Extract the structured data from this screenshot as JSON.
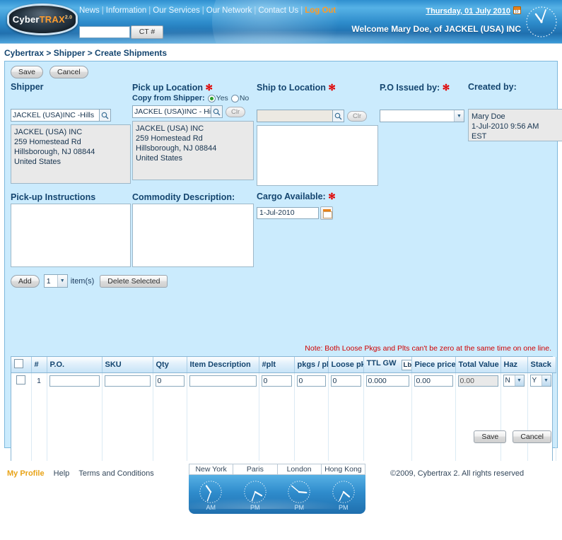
{
  "header": {
    "logo": {
      "part1": "Cyber",
      "part2": "TRAX",
      "version": "2.0"
    },
    "nav": [
      {
        "label": "News",
        "type": "link"
      },
      {
        "label": "Information",
        "type": "link"
      },
      {
        "label": "Our Services",
        "type": "link"
      },
      {
        "label": "Our Network",
        "type": "link"
      },
      {
        "label": "Contact Us",
        "type": "link"
      },
      {
        "label": "Log Out",
        "type": "logout"
      }
    ],
    "ct_search": {
      "value": "",
      "button_label": "CT #"
    },
    "date": "Thursday, 01 July 2010",
    "welcome": "Welcome Mary Doe, of JACKEL (USA) INC",
    "calendar_icon": "calendar-icon",
    "analog_clock_icon": "analog-clock-icon"
  },
  "breadcrumb": "Cybertrax > Shipper > Create Shipments",
  "toolbar": {
    "save_label": "Save",
    "cancel_label": "Cancel"
  },
  "form": {
    "shipper": {
      "title": "Shipper",
      "lookup_value": "JACKEL (USA)INC -Hills",
      "lookup_icon": "magnifier-icon",
      "address": "JACKEL (USA) INC\n259 Homestead Rd\nHillsborough, NJ  08844\nUnited States"
    },
    "pickup": {
      "title": "Pick up Location",
      "required_mark": "✻",
      "copy_label": "Copy from Shipper:",
      "yes_label": "Yes",
      "no_label": "No",
      "copy_selected": "Yes",
      "lookup_value": "JACKEL (USA)INC - Hills",
      "lookup_icon": "magnifier-icon",
      "clear_label": "Clr",
      "address": "JACKEL (USA) INC\n259 Homestead Rd\nHillsborough, NJ  08844\nUnited States"
    },
    "shipto": {
      "title": "Ship to Location",
      "required_mark": "✻",
      "lookup_value": "",
      "lookup_placeholder": "",
      "lookup_icon": "magnifier-icon",
      "clear_label": "Clr",
      "address": ""
    },
    "po_issued": {
      "title": "P.O Issued by:",
      "required_mark": "✻",
      "selected": ""
    },
    "created_by": {
      "title": "Created by:",
      "value": "Mary Doe\n1-Jul-2010  9:56 AM\nEST"
    },
    "pickup_instructions": {
      "title": "Pick-up Instructions",
      "value": ""
    },
    "commodity_description": {
      "title": "Commodity Description:",
      "value": ""
    },
    "cargo_available": {
      "title": "Cargo Available:",
      "required_mark": "✻",
      "value": "1-Jul-2010",
      "calendar_icon": "calendar-picker-icon"
    }
  },
  "items": {
    "add_label": "Add",
    "count_value": "1",
    "items_word": "item(s)",
    "delete_label": "Delete Selected",
    "note": "Note: Both Loose Pkgs and Plts can't be zero at the same time on one line.",
    "columns": [
      "",
      "#",
      "P.O.",
      "SKU",
      "Qty",
      "Item Description",
      "#plt",
      "pkgs / plt",
      "Loose pkg",
      "TTL GW",
      "Piece price",
      "Total Value",
      "Haz",
      "Stack"
    ],
    "unit_select": {
      "value": "Lb"
    },
    "rows": [
      {
        "checked": false,
        "num": "1",
        "po": "",
        "sku": "",
        "qty": "0",
        "description": "",
        "plt": "0",
        "pkgs_per_plt": "0",
        "loose_pkgs": "0",
        "ttl_gw": "0.000",
        "piece_price": "0.00",
        "total_value": "0.00",
        "haz": "N",
        "stack": "Y"
      }
    ]
  },
  "bottom_toolbar": {
    "save_label": "Save",
    "cancel_label": "Cancel"
  },
  "footer": {
    "my_profile": "My Profile",
    "help": "Help",
    "terms": "Terms and Conditions",
    "copyright": "©2009, Cybertrax 2. All rights reserved",
    "clocks": [
      {
        "city": "New York",
        "ampm": "AM",
        "hour_deg": -35,
        "minute_deg": 200
      },
      {
        "city": "Paris",
        "ampm": "PM",
        "hour_deg": 120,
        "minute_deg": 200
      },
      {
        "city": "London",
        "ampm": "PM",
        "hour_deg": 95,
        "minute_deg": 310
      },
      {
        "city": "Hong Kong",
        "ampm": "PM",
        "hour_deg": 130,
        "minute_deg": 205
      }
    ]
  },
  "colors": {
    "panel_bg": "#cbebfd",
    "header_blue": "#2e8ccb",
    "accent_orange": "#ff9b24",
    "required_red": "#e00000",
    "note_red": "#d00000",
    "title_blue": "#14456f"
  }
}
